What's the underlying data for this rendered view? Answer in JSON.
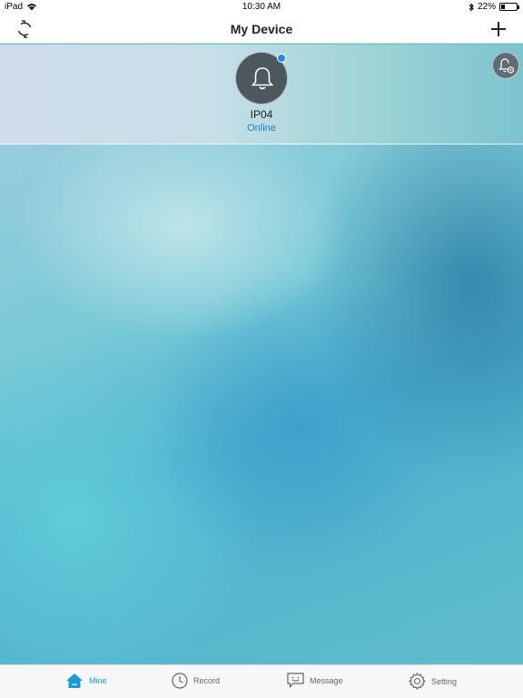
{
  "status_bar": {
    "carrier": "iPad",
    "time": "10:30 AM",
    "battery": "22%",
    "battery_level": 0.22,
    "icons": [
      "wifi-icon",
      "bluetooth-icon",
      "battery-icon"
    ]
  },
  "nav": {
    "title": "My Device",
    "left_icon": "refresh-icon",
    "right_icon": "add-icon"
  },
  "device": {
    "name": "IP04",
    "status": "Online",
    "icon": "bell-icon",
    "status_color": "#1f7fc2"
  },
  "alarm_settings_icon": "bell-gear-icon",
  "tabs": [
    {
      "label": "Mine",
      "icon": "home-icon",
      "active": true
    },
    {
      "label": "Record",
      "icon": "clock-icon",
      "active": false
    },
    {
      "label": "Message",
      "icon": "message-icon",
      "active": false
    },
    {
      "label": "Setting",
      "icon": "gear-icon",
      "active": false
    }
  ],
  "colors": {
    "accent": "#1a9bd7",
    "status_dot": "#1a8fe3"
  }
}
